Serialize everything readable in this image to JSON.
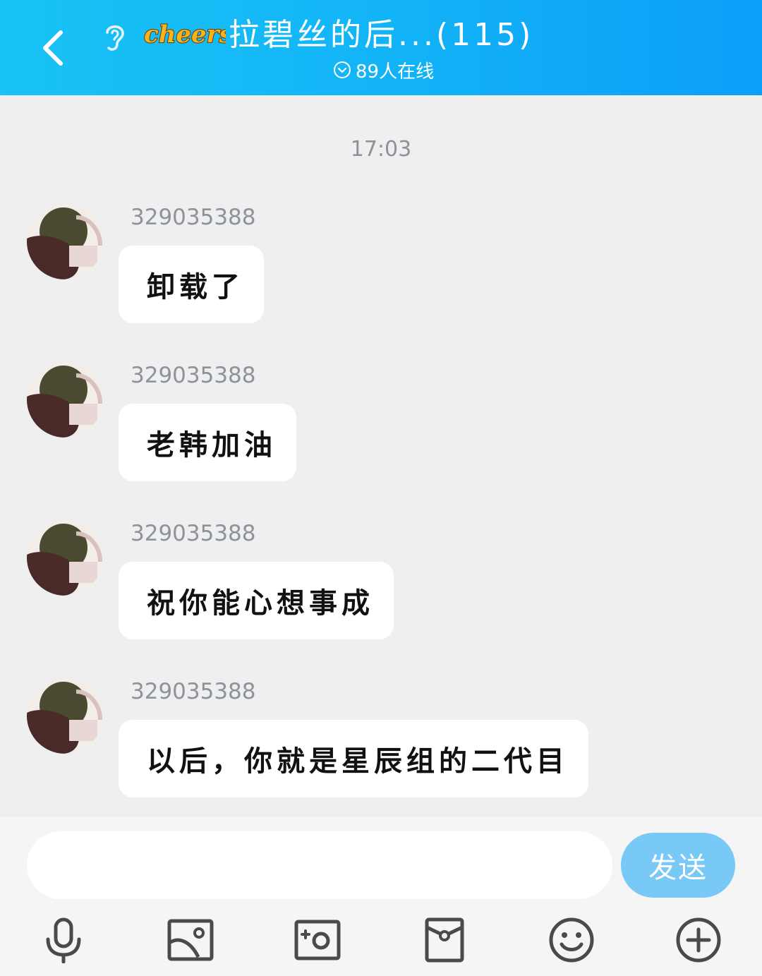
{
  "header": {
    "title": "拉碧丝的后...(115)",
    "logo_text": "cheers",
    "online_text": "89人在线"
  },
  "chat": {
    "timestamp": "17:03",
    "messages": [
      {
        "sender": "329035388",
        "text": "卸载了"
      },
      {
        "sender": "329035388",
        "text": "老韩加油"
      },
      {
        "sender": "329035388",
        "text": "祝你能心想事成"
      },
      {
        "sender": "329035388",
        "text": "以后，你就是星辰组的二代目"
      }
    ]
  },
  "input_bar": {
    "value": "",
    "send_label": "发送"
  },
  "toolbar": {
    "icons": [
      "microphone-icon",
      "image-icon",
      "camera-icon",
      "red-packet-icon",
      "emoji-icon",
      "plus-circle-icon"
    ]
  },
  "colors": {
    "header_start": "#19c3f5",
    "header_end": "#0c9ff8",
    "background": "#efefef",
    "send_button": "#79c9f6",
    "icon": "#4a4a4a"
  }
}
